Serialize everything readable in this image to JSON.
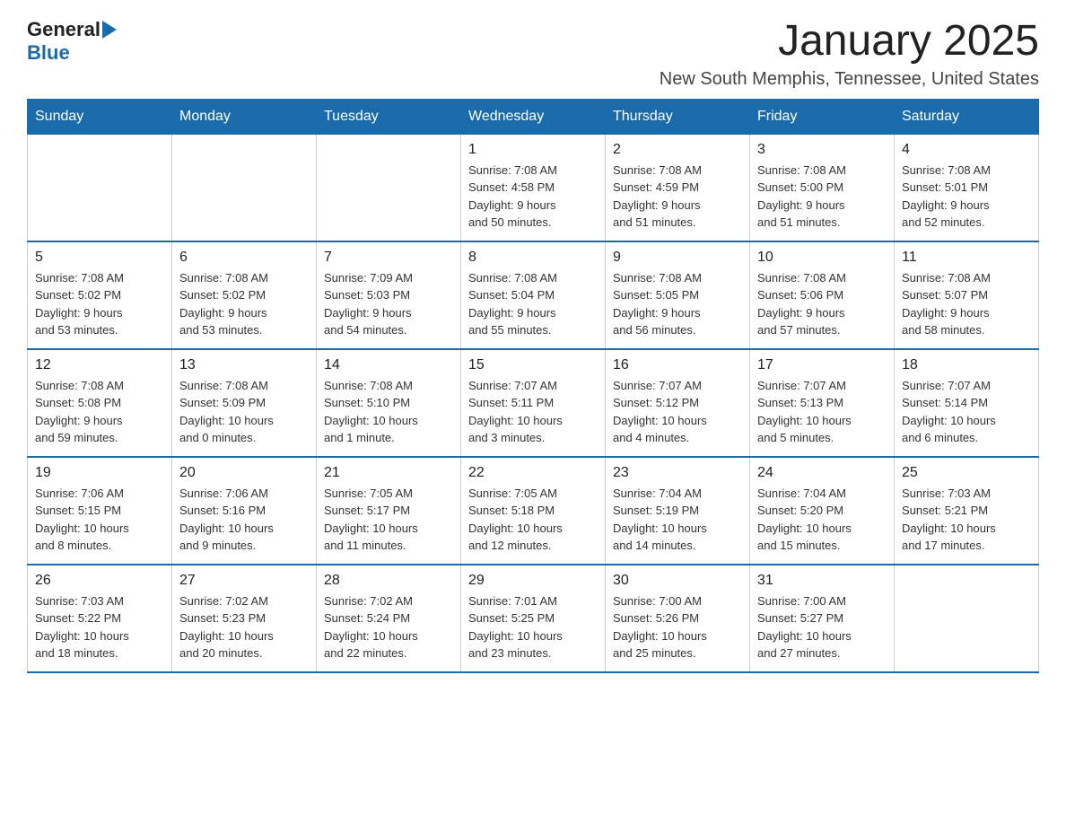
{
  "logo": {
    "general": "General",
    "blue": "Blue"
  },
  "title": "January 2025",
  "location": "New South Memphis, Tennessee, United States",
  "days_of_week": [
    "Sunday",
    "Monday",
    "Tuesday",
    "Wednesday",
    "Thursday",
    "Friday",
    "Saturday"
  ],
  "weeks": [
    [
      {
        "day": "",
        "info": ""
      },
      {
        "day": "",
        "info": ""
      },
      {
        "day": "",
        "info": ""
      },
      {
        "day": "1",
        "info": "Sunrise: 7:08 AM\nSunset: 4:58 PM\nDaylight: 9 hours\nand 50 minutes."
      },
      {
        "day": "2",
        "info": "Sunrise: 7:08 AM\nSunset: 4:59 PM\nDaylight: 9 hours\nand 51 minutes."
      },
      {
        "day": "3",
        "info": "Sunrise: 7:08 AM\nSunset: 5:00 PM\nDaylight: 9 hours\nand 51 minutes."
      },
      {
        "day": "4",
        "info": "Sunrise: 7:08 AM\nSunset: 5:01 PM\nDaylight: 9 hours\nand 52 minutes."
      }
    ],
    [
      {
        "day": "5",
        "info": "Sunrise: 7:08 AM\nSunset: 5:02 PM\nDaylight: 9 hours\nand 53 minutes."
      },
      {
        "day": "6",
        "info": "Sunrise: 7:08 AM\nSunset: 5:02 PM\nDaylight: 9 hours\nand 53 minutes."
      },
      {
        "day": "7",
        "info": "Sunrise: 7:09 AM\nSunset: 5:03 PM\nDaylight: 9 hours\nand 54 minutes."
      },
      {
        "day": "8",
        "info": "Sunrise: 7:08 AM\nSunset: 5:04 PM\nDaylight: 9 hours\nand 55 minutes."
      },
      {
        "day": "9",
        "info": "Sunrise: 7:08 AM\nSunset: 5:05 PM\nDaylight: 9 hours\nand 56 minutes."
      },
      {
        "day": "10",
        "info": "Sunrise: 7:08 AM\nSunset: 5:06 PM\nDaylight: 9 hours\nand 57 minutes."
      },
      {
        "day": "11",
        "info": "Sunrise: 7:08 AM\nSunset: 5:07 PM\nDaylight: 9 hours\nand 58 minutes."
      }
    ],
    [
      {
        "day": "12",
        "info": "Sunrise: 7:08 AM\nSunset: 5:08 PM\nDaylight: 9 hours\nand 59 minutes."
      },
      {
        "day": "13",
        "info": "Sunrise: 7:08 AM\nSunset: 5:09 PM\nDaylight: 10 hours\nand 0 minutes."
      },
      {
        "day": "14",
        "info": "Sunrise: 7:08 AM\nSunset: 5:10 PM\nDaylight: 10 hours\nand 1 minute."
      },
      {
        "day": "15",
        "info": "Sunrise: 7:07 AM\nSunset: 5:11 PM\nDaylight: 10 hours\nand 3 minutes."
      },
      {
        "day": "16",
        "info": "Sunrise: 7:07 AM\nSunset: 5:12 PM\nDaylight: 10 hours\nand 4 minutes."
      },
      {
        "day": "17",
        "info": "Sunrise: 7:07 AM\nSunset: 5:13 PM\nDaylight: 10 hours\nand 5 minutes."
      },
      {
        "day": "18",
        "info": "Sunrise: 7:07 AM\nSunset: 5:14 PM\nDaylight: 10 hours\nand 6 minutes."
      }
    ],
    [
      {
        "day": "19",
        "info": "Sunrise: 7:06 AM\nSunset: 5:15 PM\nDaylight: 10 hours\nand 8 minutes."
      },
      {
        "day": "20",
        "info": "Sunrise: 7:06 AM\nSunset: 5:16 PM\nDaylight: 10 hours\nand 9 minutes."
      },
      {
        "day": "21",
        "info": "Sunrise: 7:05 AM\nSunset: 5:17 PM\nDaylight: 10 hours\nand 11 minutes."
      },
      {
        "day": "22",
        "info": "Sunrise: 7:05 AM\nSunset: 5:18 PM\nDaylight: 10 hours\nand 12 minutes."
      },
      {
        "day": "23",
        "info": "Sunrise: 7:04 AM\nSunset: 5:19 PM\nDaylight: 10 hours\nand 14 minutes."
      },
      {
        "day": "24",
        "info": "Sunrise: 7:04 AM\nSunset: 5:20 PM\nDaylight: 10 hours\nand 15 minutes."
      },
      {
        "day": "25",
        "info": "Sunrise: 7:03 AM\nSunset: 5:21 PM\nDaylight: 10 hours\nand 17 minutes."
      }
    ],
    [
      {
        "day": "26",
        "info": "Sunrise: 7:03 AM\nSunset: 5:22 PM\nDaylight: 10 hours\nand 18 minutes."
      },
      {
        "day": "27",
        "info": "Sunrise: 7:02 AM\nSunset: 5:23 PM\nDaylight: 10 hours\nand 20 minutes."
      },
      {
        "day": "28",
        "info": "Sunrise: 7:02 AM\nSunset: 5:24 PM\nDaylight: 10 hours\nand 22 minutes."
      },
      {
        "day": "29",
        "info": "Sunrise: 7:01 AM\nSunset: 5:25 PM\nDaylight: 10 hours\nand 23 minutes."
      },
      {
        "day": "30",
        "info": "Sunrise: 7:00 AM\nSunset: 5:26 PM\nDaylight: 10 hours\nand 25 minutes."
      },
      {
        "day": "31",
        "info": "Sunrise: 7:00 AM\nSunset: 5:27 PM\nDaylight: 10 hours\nand 27 minutes."
      },
      {
        "day": "",
        "info": ""
      }
    ]
  ]
}
